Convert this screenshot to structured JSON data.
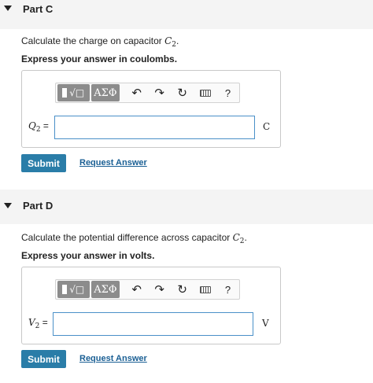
{
  "toolbar": {
    "templates_label": "√□",
    "symbols_label": "AΣΦ",
    "undo_glyph": "↶",
    "redo_glyph": "↷",
    "reset_glyph": "↻",
    "help_label": "?",
    "icons": [
      "templates-icon",
      "symbols-icon",
      "undo-icon",
      "redo-icon",
      "reset-icon",
      "keyboard-icon",
      "help-icon"
    ]
  },
  "parts": [
    {
      "title": "Part C",
      "question_prefix": "Calculate the charge on capacitor ",
      "question_var": "C",
      "question_var_sub": "2",
      "question_suffix": ".",
      "instruction": "Express your answer in coulombs.",
      "var_label": "Q",
      "var_sub": "2",
      "equals": "=",
      "input_value": "",
      "unit": "C",
      "submit_label": "Submit",
      "request_label": "Request Answer"
    },
    {
      "title": "Part D",
      "question_prefix": "Calculate the potential difference across capacitor ",
      "question_var": "C",
      "question_var_sub": "2",
      "question_suffix": ".",
      "instruction": "Express your answer in volts.",
      "var_label": "V",
      "var_sub": "2",
      "equals": "=",
      "input_value": "",
      "unit": "V",
      "submit_label": "Submit",
      "request_label": "Request Answer"
    }
  ]
}
